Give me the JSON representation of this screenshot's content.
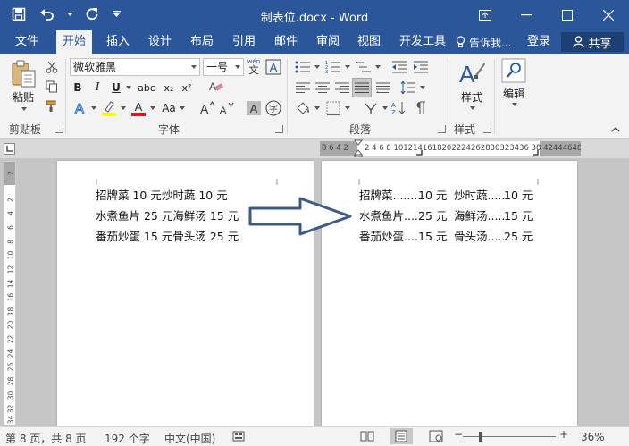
{
  "window": {
    "title": "制表位.docx - Word"
  },
  "tabs": [
    {
      "label": "文件",
      "active": false
    },
    {
      "label": "开始",
      "active": true
    },
    {
      "label": "插入",
      "active": false
    },
    {
      "label": "设计",
      "active": false
    },
    {
      "label": "布局",
      "active": false
    },
    {
      "label": "引用",
      "active": false
    },
    {
      "label": "邮件",
      "active": false
    },
    {
      "label": "审阅",
      "active": false
    },
    {
      "label": "视图",
      "active": false
    },
    {
      "label": "开发工具",
      "active": false
    }
  ],
  "tell_me": "告诉我...",
  "sign_in": "登录",
  "share": "共享",
  "ribbon": {
    "paste_label": "粘贴",
    "font_name": "微软雅黑",
    "font_size": "一号",
    "wen_label": "wén",
    "wen_char": "文",
    "bold": "B",
    "italic": "I",
    "underline": "U",
    "strike": "abc",
    "subscript": "x₂",
    "superscript": "x²",
    "aa_label": "Aa",
    "styles_label": "样式",
    "editing_label": "编辑",
    "group_clipboard": "剪贴板",
    "group_font": "字体",
    "group_paragraph": "段落",
    "group_styles": "样式",
    "colors": {
      "highlight": "#ffff00",
      "font_color": "#e81123",
      "accent": "#2b579a"
    }
  },
  "ruler": {
    "horizontal_left": "8 6 4 2",
    "horizontal_right": "2  4  6  8 1012141618202224262830323436 38   42444648",
    "vertical_ticks": [
      "2",
      "2",
      "4",
      "6",
      "8",
      "10",
      "12",
      "14",
      "16",
      "18",
      "20",
      "22",
      "24",
      "26",
      "28",
      "30",
      "32",
      "34"
    ]
  },
  "left_page": {
    "lines": [
      "招牌菜 10 元炒时蔬 10 元",
      "水煮鱼片 25 元海鲜汤 15 元",
      "番茄炒蛋 15 元骨头汤 25 元"
    ]
  },
  "right_page": {
    "rows": [
      {
        "item1": "招牌菜........",
        "price1": "10 元",
        "item2": "炒时蔬.....",
        "price2": "10 元"
      },
      {
        "item1": "水煮鱼片....",
        "price1": "25 元",
        "item2": "海鲜汤.....",
        "price2": "15 元"
      },
      {
        "item1": "番茄炒蛋....",
        "price1": "15 元",
        "item2": "骨头汤.....",
        "price2": "25 元"
      }
    ]
  },
  "status": {
    "page": "第 8 页，共 8 页",
    "words": "192 个字",
    "language": "中文(中国)",
    "zoom": "36%",
    "zoom_minus": "−",
    "zoom_plus": "+"
  }
}
